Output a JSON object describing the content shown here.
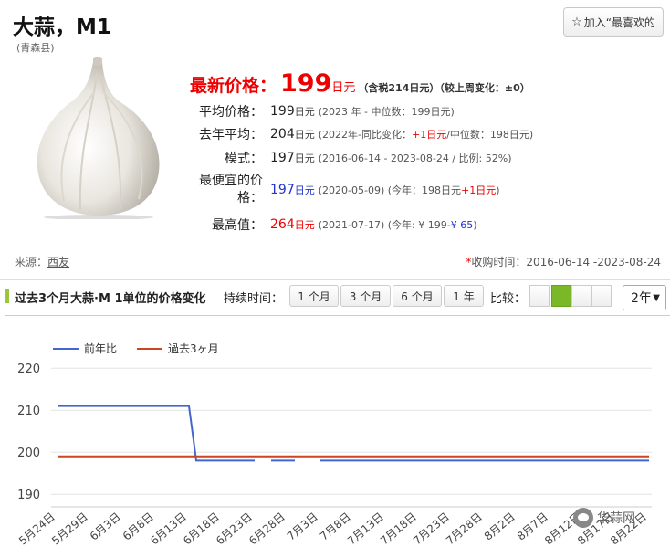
{
  "header": {
    "title": "大蒜，M1",
    "subtitle": "(青森县)",
    "favorite_label": "加入“最喜欢的"
  },
  "price": {
    "latest_label": "最新价格：",
    "latest_value": "199",
    "latest_unit": "日元",
    "latest_note": "（含税214日元）（较上周变化：±0）",
    "rows": [
      {
        "label": "平均价格：",
        "value": "199",
        "unit": "日元",
        "note": "(2023 年 - 中位数：199日元)"
      },
      {
        "label": "去年平均：",
        "value": "204",
        "unit": "日元",
        "note_a": "(2022年-同比变化：",
        "note_red": "+1日元",
        "note_b": "/中位数：198日元)"
      },
      {
        "label": "模式：",
        "value": "197",
        "unit": "日元",
        "note": "(2016-06-14 - 2023-08-24 / 比例: 52%)"
      },
      {
        "label": "最便宜的价格：",
        "value": "197",
        "unit": "日元",
        "note_a": "(2020-05-09) (今年：198日元 ",
        "note_red": "+1日元",
        "note_b": ")"
      },
      {
        "label": "最高值：",
        "value": "264",
        "unit": "日元",
        "note_a": "(2021-07-17) (今年: ¥ 199- ",
        "note_blue": "¥ 65",
        "note_b": " )"
      }
    ]
  },
  "source": {
    "label": "来源：",
    "link": "西友"
  },
  "collected": {
    "asterisk": "*",
    "text": "收购时间：2016-06-14 -2023-08-24"
  },
  "toolbar": {
    "title": "过去3个月大蒜·M 1单位的价格变化",
    "duration_label": "持续时间：",
    "durations": [
      "1 个月",
      "3 个月",
      "6 个月",
      "1 年"
    ],
    "compare_label": "比较：",
    "select_value": "2年"
  },
  "colors": {
    "series_prev_year": "#4466cc",
    "series_3m": "#cc4422",
    "accent": "#7ab828",
    "price_red": "#e00000"
  },
  "chart_data": {
    "type": "line",
    "x": [
      "5月24日",
      "5月29日",
      "6月3日",
      "6月8日",
      "6月13日",
      "6月18日",
      "6月23日",
      "6月28日",
      "7月3日",
      "7月8日",
      "7月13日",
      "7月18日",
      "7月23日",
      "7月28日",
      "8月2日",
      "8月7日",
      "8月12日",
      "8月17日",
      "8月22日"
    ],
    "ylim": [
      187,
      222
    ],
    "yticks": [
      190,
      200,
      210,
      220
    ],
    "legend": "top-left",
    "grid": true,
    "series": [
      {
        "name": "前年比",
        "color": "#4466cc",
        "values": [
          211,
          211,
          211,
          211,
          211,
          198,
          198,
          null,
          198,
          198,
          198,
          198,
          198,
          198,
          198,
          198,
          198,
          198,
          198
        ]
      },
      {
        "name": "過去3ヶ月",
        "color": "#cc4422",
        "values": [
          199,
          199,
          199,
          199,
          199,
          199,
          199,
          199,
          199,
          199,
          199,
          199,
          199,
          199,
          199,
          199,
          199,
          199,
          199
        ]
      }
    ]
  },
  "watermark": "华蒜网"
}
